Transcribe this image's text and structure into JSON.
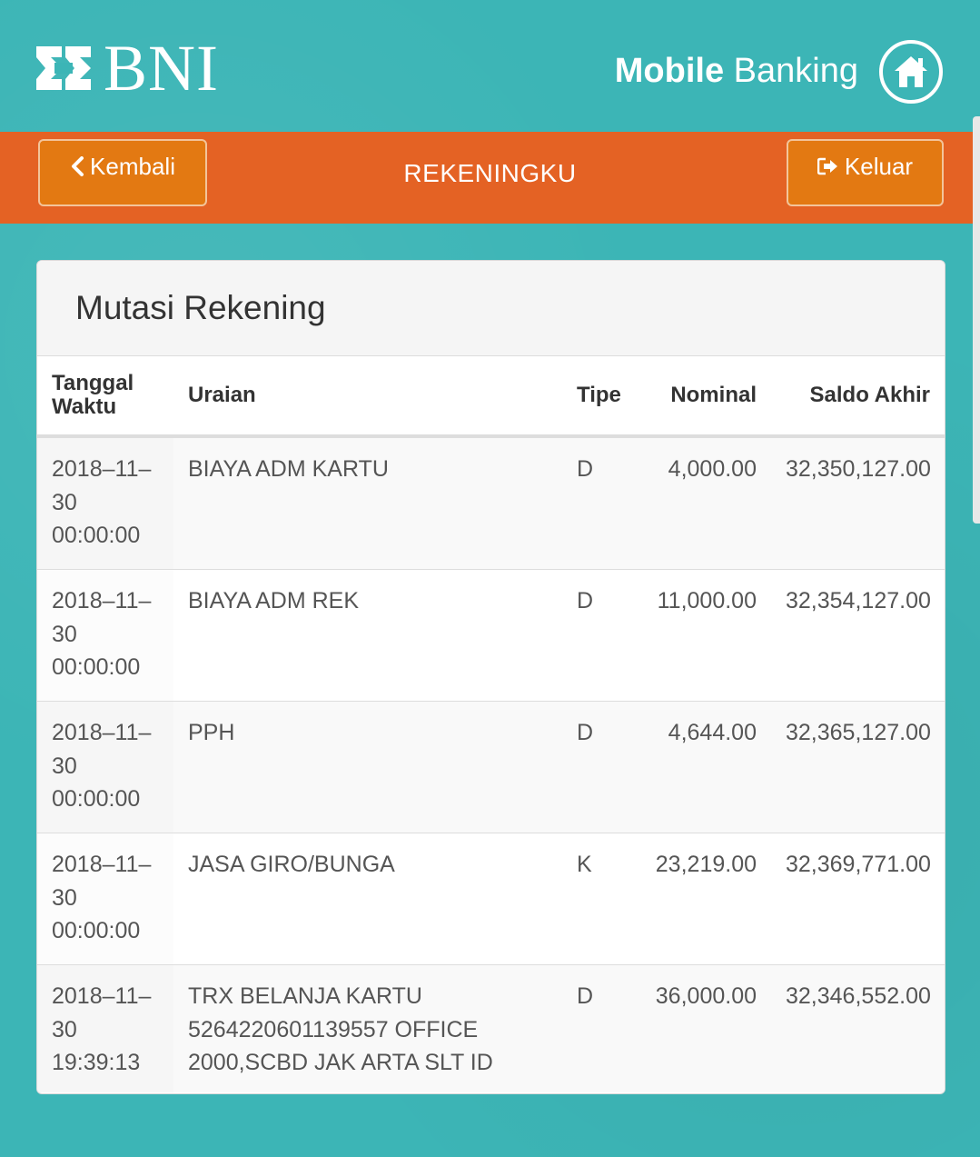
{
  "header": {
    "logo_text": "BNI",
    "app_title_bold": "Mobile",
    "app_title_rest": " Banking",
    "home_icon": "home-icon"
  },
  "nav": {
    "back_label": "Kembali",
    "back_icon": "chevron-left-icon",
    "title": "REKENINGKU",
    "exit_label": "Keluar",
    "exit_icon": "sign-out-icon"
  },
  "panel": {
    "title": "Mutasi Rekening"
  },
  "table": {
    "headers": {
      "date_line1": "Tanggal",
      "date_line2": "Waktu",
      "desc": "Uraian",
      "type": "Tipe",
      "amount": "Nominal",
      "balance": "Saldo Akhir"
    },
    "rows": [
      {
        "date": "2018–11–",
        "day": "30",
        "time": "00:00:00",
        "desc_lines": [
          "BIAYA ADM KARTU",
          "",
          ""
        ],
        "type": "D",
        "amount": "4,000.00",
        "balance": "32,350,127.00"
      },
      {
        "date": "2018–11–",
        "day": "30",
        "time": "00:00:00",
        "desc_lines": [
          "BIAYA ADM REK",
          "",
          ""
        ],
        "type": "D",
        "amount": "11,000.00",
        "balance": "32,354,127.00"
      },
      {
        "date": "2018–11–",
        "day": "30",
        "time": "00:00:00",
        "desc_lines": [
          "PPH",
          "",
          ""
        ],
        "type": "D",
        "amount": "4,644.00",
        "balance": "32,365,127.00"
      },
      {
        "date": "2018–11–",
        "day": "30",
        "time": "00:00:00",
        "desc_lines": [
          "JASA GIRO/BUNGA",
          "",
          ""
        ],
        "type": "K",
        "amount": "23,219.00",
        "balance": "32,369,771.00"
      },
      {
        "date": "2018–11–",
        "day": "30",
        "time": "19:39:13",
        "desc_lines": [
          "TRX BELANJA KARTU",
          "5264220601139557 OFFICE",
          "2000,SCBD JAK ARTA SLT ID"
        ],
        "type": "D",
        "amount": "36,000.00",
        "balance": "32,346,552.00"
      }
    ]
  },
  "colors": {
    "background": "#3cb5b6",
    "nav_bar": "#e46224",
    "nav_button": "#e37912"
  }
}
